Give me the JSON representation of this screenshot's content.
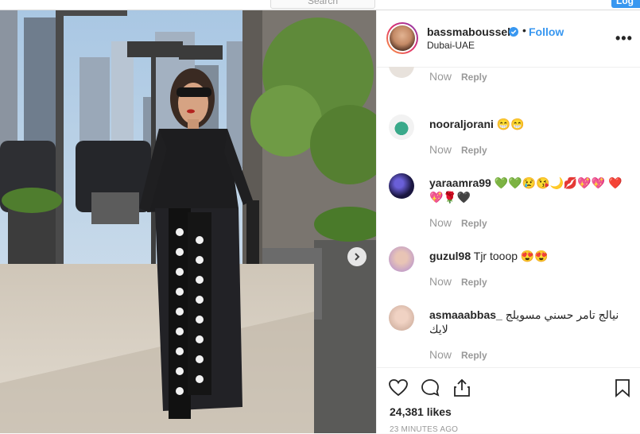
{
  "nav": {
    "search_placeholder": "Search",
    "login_label": "Log"
  },
  "post": {
    "username": "bassmaboussel",
    "follow_label": "Follow",
    "separator": "•",
    "location": "Dubai-UAE",
    "more_label": "•••",
    "likes": "24,381 likes",
    "timestamp": "23 MINUTES AGO"
  },
  "comments": [
    {
      "user": "",
      "text": "",
      "time": "Now",
      "reply": "Reply"
    },
    {
      "user": "nooraljorani",
      "text": "😁😁",
      "time": "Now",
      "reply": "Reply"
    },
    {
      "user": "yaraamra99",
      "text": "💚💚😢😘🌙💋💖💖 ❤️💖🌹🖤",
      "time": "Now",
      "reply": "Reply"
    },
    {
      "user": "guzul98",
      "text": "Tjr tooop 😍😍",
      "time": "Now",
      "reply": "Reply"
    },
    {
      "user": "asmaaabbas_",
      "text": "نيالج تامر حسني مسويلج لايك",
      "time": "Now",
      "reply": "Reply"
    }
  ],
  "colors": {
    "accent": "#3897f0",
    "muted": "#999999",
    "text": "#262626"
  },
  "icons": [
    "verified-badge-icon",
    "more-options-icon",
    "heart-icon",
    "comment-icon",
    "share-icon",
    "bookmark-icon",
    "chevron-right-icon"
  ]
}
